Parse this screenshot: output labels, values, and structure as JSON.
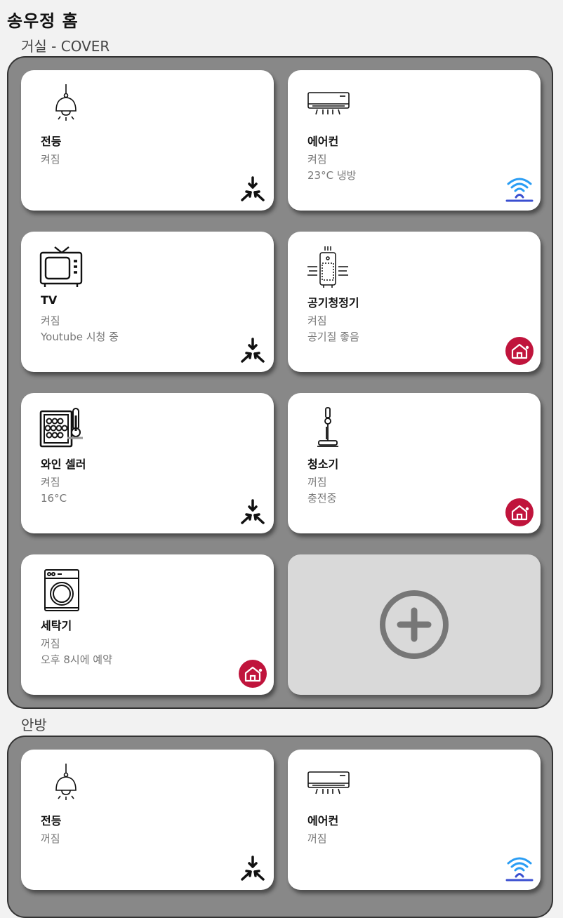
{
  "home": {
    "title": "송우정 홈"
  },
  "rooms": [
    {
      "title": "거실 - COVER",
      "devices": [
        {
          "name": "전등",
          "status": [
            "켜짐"
          ],
          "icon": "pendant-lamp-icon",
          "badge": "snowflake-icon"
        },
        {
          "name": "에어컨",
          "status": [
            "켜짐",
            "23°C 냉방"
          ],
          "icon": "air-conditioner-icon",
          "badge": "wifi-icon"
        },
        {
          "name": "TV",
          "status": [
            "켜짐",
            "Youtube 시청 중"
          ],
          "icon": "tv-icon",
          "badge": "snowflake-icon"
        },
        {
          "name": "공기청정기",
          "status": [
            "켜짐",
            "공기질 좋음"
          ],
          "icon": "air-purifier-icon",
          "badge": "home-badge-icon"
        },
        {
          "name": "와인 셀러",
          "status": [
            "켜짐",
            "16°C"
          ],
          "icon": "wine-cellar-icon",
          "badge": "snowflake-icon"
        },
        {
          "name": "청소기",
          "status": [
            "꺼짐",
            "충전중"
          ],
          "icon": "vacuum-icon",
          "badge": "home-badge-icon"
        },
        {
          "name": "세탁기",
          "status": [
            "꺼짐",
            "오후 8시에 예약"
          ],
          "icon": "washing-machine-icon",
          "badge": "home-badge-icon"
        }
      ]
    },
    {
      "title": "안방",
      "devices": [
        {
          "name": "전등",
          "status": [
            "꺼짐"
          ],
          "icon": "pendant-lamp-icon",
          "badge": "snowflake-icon"
        },
        {
          "name": "에어컨",
          "status": [
            "꺼짐"
          ],
          "icon": "air-conditioner-icon",
          "badge": "wifi-icon"
        }
      ]
    }
  ],
  "colors": {
    "page_bg": "#f2f2f2",
    "room_bg": "#888888",
    "add_card_bg": "#d9d9d9",
    "badge_red": "#c0143c",
    "wifi_blue": "#2a9df4"
  }
}
